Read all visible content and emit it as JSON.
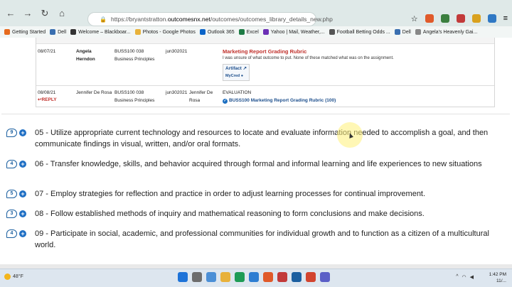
{
  "browser": {
    "url_prefix": "https://bryantstratton.",
    "url_domain": "outcomesnx.net",
    "url_path": "/outcomes/outcomes_library_details_new.php"
  },
  "bookmarks": [
    {
      "label": "Getting Started",
      "color": "#e66b1e"
    },
    {
      "label": "Dell",
      "color": "#3a6fb0"
    },
    {
      "label": "Welcome – Blackboar...",
      "color": "#333333"
    },
    {
      "label": "Photos - Google Photos",
      "color": "#e8b23a"
    },
    {
      "label": "Outlook 365",
      "color": "#0a64c8"
    },
    {
      "label": "Excel",
      "color": "#1e7b45"
    },
    {
      "label": "Yahoo | Mail, Weather,...",
      "color": "#6b2fb5"
    },
    {
      "label": "Football Betting Odds ...",
      "color": "#555555"
    },
    {
      "label": "Dell",
      "color": "#3a6fb0"
    },
    {
      "label": "Angela's Heavenly Gai...",
      "color": "#888888"
    }
  ],
  "assessments": {
    "row1": {
      "date": "08/07/21",
      "first": "Angela",
      "last": "Herndon",
      "course": "BUSS100 038",
      "course_name": "Business Principles",
      "term": "jun302021",
      "rubric_title": "Marketing Report Grading Rubric",
      "comment": "I was unsure of what outcome to put. None of these matched what was on the assignment.",
      "artifact_label": "Artifact",
      "mycred_label": "MyCred"
    },
    "row2": {
      "date": "08/08/21",
      "reply_label": "REPLY",
      "assessor": "Jennifer De Rosa",
      "course": "BUSS100 038",
      "course_name": "Business Principles",
      "term": "jun302021",
      "evaluator_first": "Jennifer De",
      "evaluator_last": "Rosa",
      "evaluation_label": "EVALUATION",
      "rubric_link": "BUSS100 Marketing Report Grading Rubric (100)"
    }
  },
  "outcomes": [
    {
      "count": "9",
      "text": "05 - Utilize appropriate current technology and resources to locate and evaluate information needed to accomplish a goal, and then communicate findings in visual, written, and/or oral formats."
    },
    {
      "count": "4",
      "text": "06 - Transfer knowledge, skills, and behavior acquired through formal and informal learning and life experiences to new situations"
    },
    {
      "count": "5",
      "text": "07 - Employ strategies for reflection and practice in order to adjust learning processes for continual improvement."
    },
    {
      "count": "3",
      "text": "08 - Follow established methods of inquiry and mathematical reasoning to form conclusions and make decisions."
    },
    {
      "count": "4",
      "text": "09 - Participate in social, academic, and professional communities for individual growth and to function as a citizen of a multicultural world."
    }
  ],
  "taskbar": {
    "weather": "48°F",
    "time": "1:42 PM",
    "date": "11/..."
  }
}
